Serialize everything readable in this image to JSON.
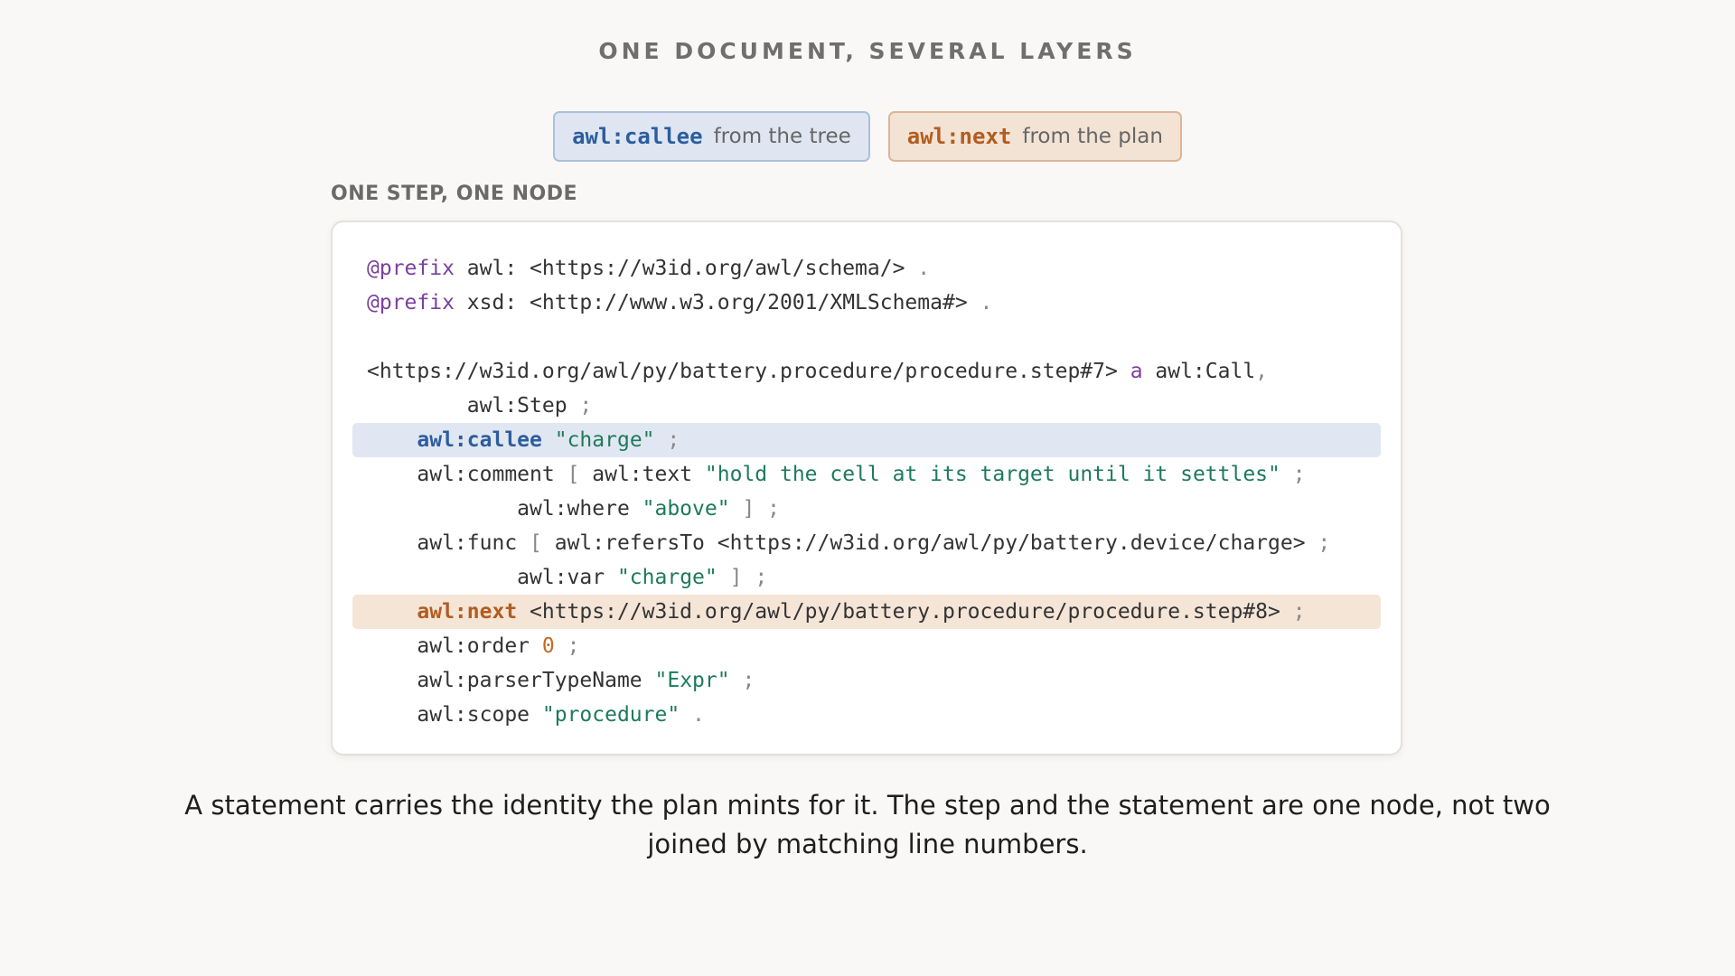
{
  "page": {
    "title": "ONE DOCUMENT, SEVERAL LAYERS",
    "section_label": "ONE STEP, ONE NODE",
    "caption": "A statement carries the identity the plan mints for it. The step and the statement are one node, not two joined by matching line numbers."
  },
  "legend": {
    "tree": {
      "key": "awl:callee",
      "desc": "from the tree",
      "color": "#2c5d9e",
      "background": "#dfe6f1"
    },
    "plan": {
      "key": "awl:next",
      "desc": "from the plan",
      "color": "#b35c1f",
      "background": "#f3e3d5"
    }
  },
  "code": {
    "prefix_kw": "@prefix",
    "prefix_awl": " awl: <https://w3id.org/awl/schema/> ",
    "prefix_xsd": " xsd: <http://www.w3.org/2001/XMLSchema#> ",
    "dot": ".",
    "semi": ";",
    "comma": ",",
    "subject": "<https://w3id.org/awl/py/battery.procedure/procedure.step#7> ",
    "a_kw": "a",
    "type_call": " awl:Call",
    "type_step": "        awl:Step ",
    "callee_pred": "awl:callee",
    "callee_val": "\"charge\"",
    "comment_pred": "    awl:comment ",
    "bracket_open": "[",
    "bracket_close": "]",
    "text_pred": " awl:text ",
    "text_val": "\"hold the cell at its target until it settles\"",
    "where_pred": "            awl:where ",
    "where_val": "\"above\"",
    "func_pred": "    awl:func ",
    "refers_pred": " awl:refersTo <https://w3id.org/awl/py/battery.device/charge> ",
    "var_pred": "            awl:var ",
    "var_val": "\"charge\"",
    "next_pred": "awl:next",
    "next_val": " <https://w3id.org/awl/py/battery.procedure/procedure.step#8> ",
    "order_pred": "    awl:order ",
    "order_val": "0",
    "parser_pred": "    awl:parserTypeName ",
    "parser_val": "\"Expr\"",
    "scope_pred": "    awl:scope ",
    "scope_val": "\"procedure\""
  }
}
